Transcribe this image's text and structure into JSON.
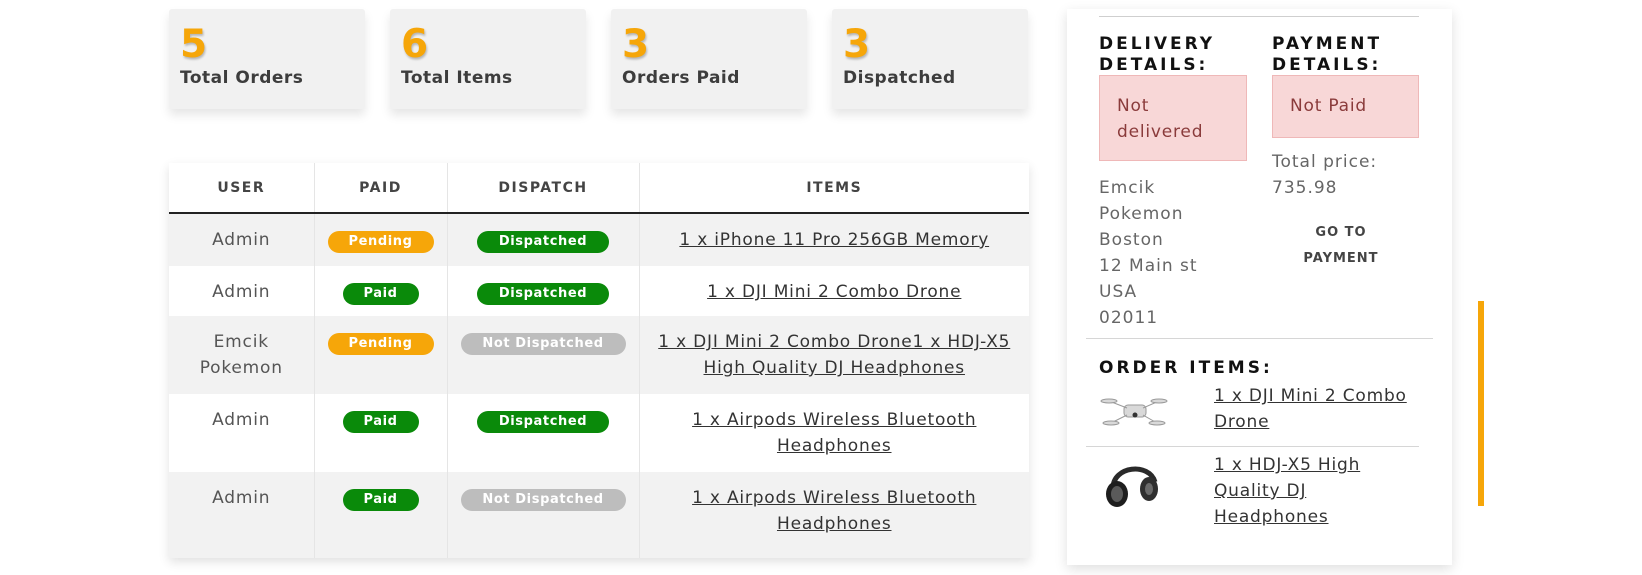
{
  "stats": [
    {
      "value": "5",
      "label": "Total Orders"
    },
    {
      "value": "6",
      "label": "Total Items"
    },
    {
      "value": "3",
      "label": "Orders Paid"
    },
    {
      "value": "3",
      "label": "Dispatched"
    }
  ],
  "orders_table": {
    "headers": [
      "USER",
      "PAID",
      "DISPATCH",
      "ITEMS"
    ],
    "rows": [
      {
        "user": "Admin",
        "paid": "Pending",
        "paid_status": "pending",
        "dispatch": "Dispatched",
        "dispatch_status": "dispatched",
        "items": "1 x iPhone 11 Pro 256GB Memory"
      },
      {
        "user": "Admin",
        "paid": "Paid",
        "paid_status": "paid",
        "dispatch": "Dispatched",
        "dispatch_status": "dispatched",
        "items": "1 x DJI Mini 2 Combo Drone"
      },
      {
        "user": "Emcik Pokemon",
        "paid": "Pending",
        "paid_status": "pending",
        "dispatch": "Not Dispatched",
        "dispatch_status": "notdispatched",
        "items": "1 x DJI Mini 2 Combo Drone1 x HDJ-X5 High Quality DJ Headphones"
      },
      {
        "user": "Admin",
        "paid": "Paid",
        "paid_status": "paid",
        "dispatch": "Dispatched",
        "dispatch_status": "dispatched",
        "items": "1 x Airpods Wireless Bluetooth Headphones"
      },
      {
        "user": "Admin",
        "paid": "Paid",
        "paid_status": "paid",
        "dispatch": "Not Dispatched",
        "dispatch_status": "notdispatched",
        "items": "1 x Airpods Wireless Bluetooth Headphones"
      }
    ]
  },
  "summary": {
    "delivery_title_line1": "DELIVERY",
    "delivery_title_line2": "DETAILS:",
    "delivery_status": "Not delivered",
    "address_lines": [
      "Emcik",
      "Pokemon",
      "Boston",
      "12 Main st",
      "USA",
      "02011"
    ],
    "payment_title_line1": "PAYMENT",
    "payment_title_line2": "DETAILS:",
    "payment_status": "Not Paid",
    "total_price_label": "Total price:",
    "total_price_value": "735.98",
    "goto_payment_line1": "GO TO",
    "goto_payment_line2": "PAYMENT",
    "order_items_title": "ORDER ITEMS:",
    "order_items": [
      {
        "name": "1 x DJI Mini 2 Combo Drone",
        "icon": "drone-image"
      },
      {
        "name": "1 x HDJ-X5 High Quality DJ Headphones",
        "icon": "headphones-image"
      }
    ]
  },
  "colors": {
    "accent": "#f6a609",
    "paid_green": "#0a8a0a",
    "not_dispatched_gray": "#bdbdbd",
    "alert_pink": "#f8d7d7"
  }
}
